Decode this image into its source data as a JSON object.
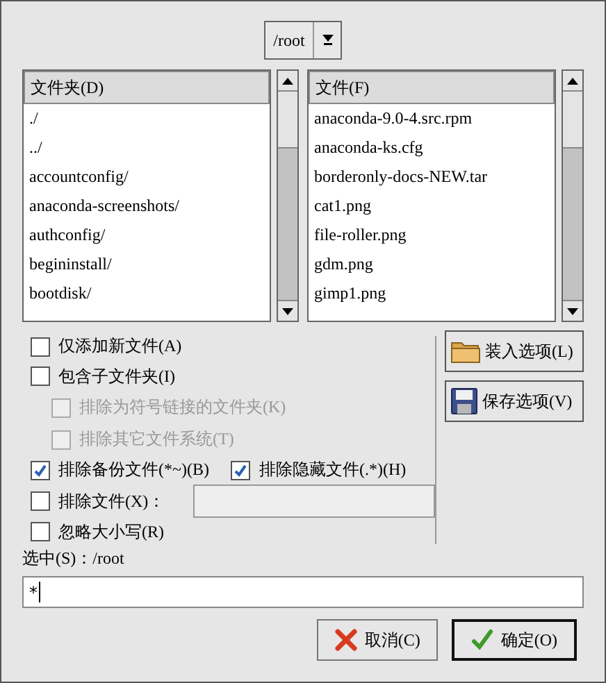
{
  "path_combo": {
    "value": "/root"
  },
  "folders": {
    "header": "文件夹(D)",
    "items": [
      "./",
      "../",
      "accountconfig/",
      "anaconda-screenshots/",
      "authconfig/",
      "begininstall/",
      "bootdisk/"
    ]
  },
  "files": {
    "header": "文件(F)",
    "items": [
      "anaconda-9.0-4.src.rpm",
      "anaconda-ks.cfg",
      "borderonly-docs-NEW.tar",
      "cat1.png",
      "file-roller.png",
      "gdm.png",
      "gimp1.png"
    ]
  },
  "options": [
    {
      "kind": "check",
      "label": "仅添加新文件(A)",
      "checked": false,
      "disabled": false
    },
    {
      "kind": "check",
      "label": "包含子文件夹(I)",
      "checked": false,
      "disabled": false,
      "children": [
        {
          "kind": "check",
          "label": "排除为符号链接的文件夹(K)",
          "checked": false,
          "disabled": true
        },
        {
          "kind": "check",
          "label": "排除其它文件系统(T)",
          "checked": false,
          "disabled": true
        }
      ]
    },
    {
      "kind": "pair",
      "items": [
        {
          "label": "排除备份文件(*~)(B)",
          "checked": true,
          "disabled": false
        },
        {
          "label": "排除隐藏文件(.*)(H)",
          "checked": true,
          "disabled": false
        }
      ]
    },
    {
      "kind": "field",
      "label": "排除文件(X)：",
      "checked": false,
      "disabled": false,
      "field_disabled": true
    },
    {
      "kind": "check",
      "label": "忽略大小写(R)",
      "checked": false,
      "disabled": false
    }
  ],
  "side_buttons": [
    {
      "kind": "load",
      "label": "装入选项(L)"
    },
    {
      "kind": "save",
      "label": "保存选项(V)"
    }
  ],
  "selection": {
    "label": "选中(S)：",
    "path": "/root",
    "value": "*"
  },
  "buttons": [
    {
      "kind": "cancel",
      "label": "取消(C)",
      "default": false
    },
    {
      "kind": "ok",
      "label": "确定(O)",
      "default": true
    }
  ]
}
